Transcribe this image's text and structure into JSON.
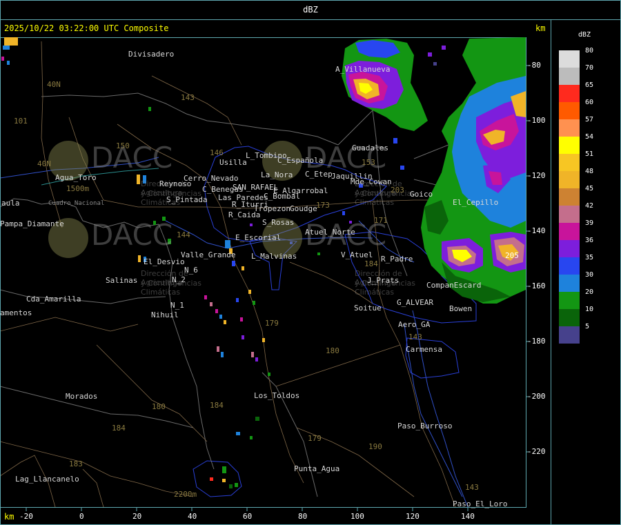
{
  "title": "dBZ",
  "subtitle": "2025/10/22 03:22:00 UTC Composite",
  "x_unit": "km",
  "y_unit": "km",
  "legend": {
    "title": "dBZ",
    "items": [
      {
        "value": "80",
        "color": "#dcdcdc"
      },
      {
        "value": "70",
        "color": "#bcbcbc"
      },
      {
        "value": "65",
        "color": "#ff2a1e"
      },
      {
        "value": "60",
        "color": "#ff5a00"
      },
      {
        "value": "57",
        "color": "#ff9150"
      },
      {
        "value": "54",
        "color": "#ffff00"
      },
      {
        "value": "51",
        "color": "#f7c623"
      },
      {
        "value": "48",
        "color": "#f0b428"
      },
      {
        "value": "45",
        "color": "#cd8232"
      },
      {
        "value": "42",
        "color": "#c46e8c"
      },
      {
        "value": "39",
        "color": "#c8149b"
      },
      {
        "value": "36",
        "color": "#7d1edc"
      },
      {
        "value": "35",
        "color": "#2846f0"
      },
      {
        "value": "30",
        "color": "#1e82dc"
      },
      {
        "value": "20",
        "color": "#139613"
      },
      {
        "value": "10",
        "color": "#0a640a"
      },
      {
        "value": "5",
        "color": "#46418c"
      }
    ]
  },
  "axes": {
    "x_ticks": [
      "-20",
      "0",
      "20",
      "40",
      "60",
      "80",
      "100",
      "120",
      "140"
    ],
    "y_ticks": [
      "-80",
      "-100",
      "-120",
      "-140",
      "-160",
      "-180",
      "-200",
      "-220"
    ]
  },
  "places": [
    {
      "name": "Divisadero"
    },
    {
      "name": "A_Villanueva"
    },
    {
      "name": "Guadales"
    },
    {
      "name": "L_Tombino"
    },
    {
      "name": "Usilla"
    },
    {
      "name": "C_Española"
    },
    {
      "name": "C_Etep"
    },
    {
      "name": "Jaquillin"
    },
    {
      "name": "Mde_Cowan"
    },
    {
      "name": "La_Nora"
    },
    {
      "name": "Agua_Toro"
    },
    {
      "name": "Reynoso"
    },
    {
      "name": "Cerro_Nevado"
    },
    {
      "name": "C_Benegas"
    },
    {
      "name": "SAN_RAFAEL"
    },
    {
      "name": "E_Algarrobal"
    },
    {
      "name": "C_Bombal"
    },
    {
      "name": "Goico"
    },
    {
      "name": "Las_Paredes"
    },
    {
      "name": "El_Cepillo"
    },
    {
      "name": "S_Pintada"
    },
    {
      "name": "R_Iturri"
    },
    {
      "name": "Tropezon"
    },
    {
      "name": "Goudge"
    },
    {
      "name": "Cuadro_Nacional"
    },
    {
      "name": "R_Caida"
    },
    {
      "name": "S_Rosas"
    },
    {
      "name": "aula"
    },
    {
      "name": "Pampa_Diamante"
    },
    {
      "name": "Atuel_Norte"
    },
    {
      "name": "E_Escorial"
    },
    {
      "name": "Valle_Grande"
    },
    {
      "name": "L_Malvinas"
    },
    {
      "name": "V_Atuel"
    },
    {
      "name": "R_Padre"
    },
    {
      "name": "El_Desvio"
    },
    {
      "name": "N_6"
    },
    {
      "name": "N_2"
    },
    {
      "name": "Salinas"
    },
    {
      "name": "J_Prats"
    },
    {
      "name": "CompanEscard"
    },
    {
      "name": "Cda_Amarilla"
    },
    {
      "name": "G_ALVEAR"
    },
    {
      "name": "N_1"
    },
    {
      "name": "Soitue"
    },
    {
      "name": "Bowen"
    },
    {
      "name": "amentos"
    },
    {
      "name": "Nihuil"
    },
    {
      "name": "Aero_GA"
    },
    {
      "name": "Carmensa"
    },
    {
      "name": "Morados"
    },
    {
      "name": "Los_Toldos"
    },
    {
      "name": "Paso_Burroso"
    },
    {
      "name": "Punta_Agua"
    },
    {
      "name": "Lag_Llancanelo"
    },
    {
      "name": "Paso_El_Loro"
    },
    {
      "name": "1500m"
    },
    {
      "name": "2200m"
    }
  ],
  "routes": [
    "40N",
    "101",
    "143",
    "150",
    "40N",
    "146",
    "153",
    "203",
    "173",
    "144",
    "171",
    "184",
    "179",
    "180",
    "184",
    "184",
    "183",
    "179",
    "190",
    "143",
    "143",
    "205",
    "180"
  ],
  "watermarks": [
    {
      "logo": "DACC",
      "line1": "Dirección de Agricultura",
      "line2": "y Contingencias Climáticas"
    },
    {
      "logo": "DACC",
      "line1": "Dirección de Agricultura",
      "line2": "y Contingencias Climáticas"
    },
    {
      "logo": "DACC",
      "line1": "Dirección de Agricultura",
      "line2": "y Contingencias Climáticas"
    },
    {
      "logo": "DACC",
      "line1": "Dirección de Agricultura",
      "line2": "y Contingencias Climáticas"
    }
  ]
}
